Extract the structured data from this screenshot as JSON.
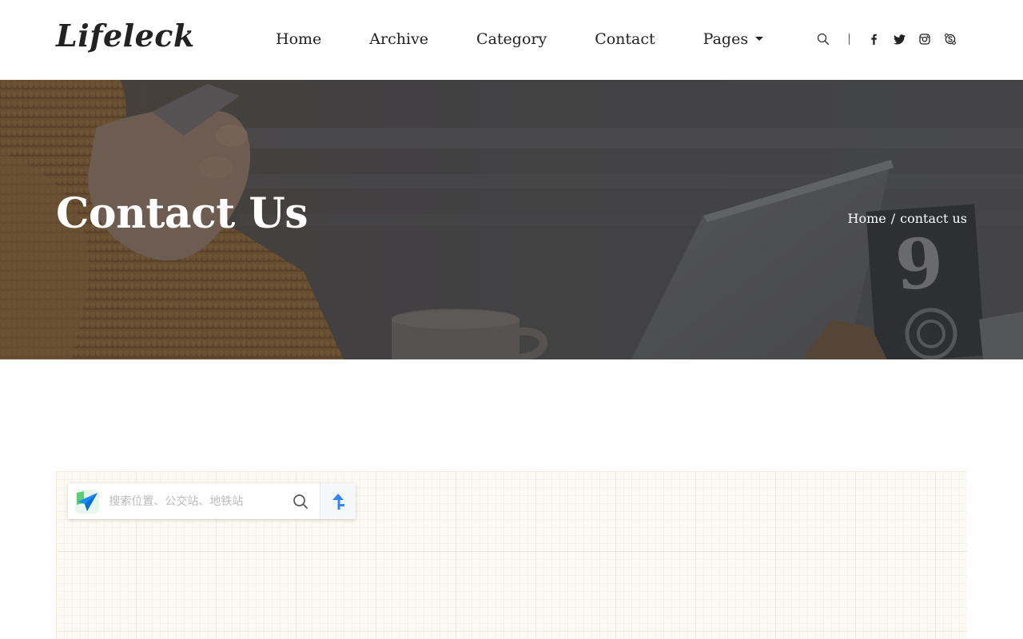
{
  "header": {
    "logo": "Lifeleck",
    "nav": [
      {
        "label": "Home"
      },
      {
        "label": "Archive"
      },
      {
        "label": "Category"
      },
      {
        "label": "Contact"
      },
      {
        "label": "Pages"
      }
    ],
    "icons": [
      "search-icon",
      "facebook-icon",
      "twitter-icon",
      "instagram-icon",
      "skype-icon"
    ]
  },
  "hero": {
    "title": "Contact Us",
    "breadcrumb": {
      "home": "Home",
      "separator": "/",
      "current": "contact us"
    },
    "overlay_color": "#2e2e30"
  },
  "map": {
    "search_placeholder": "搜索位置、公交站、地铁站",
    "search_value": "",
    "icons": [
      "map-app-logo-icon",
      "magnifier-icon",
      "route-arrow-icon"
    ],
    "accent_color": "#3385ff"
  }
}
